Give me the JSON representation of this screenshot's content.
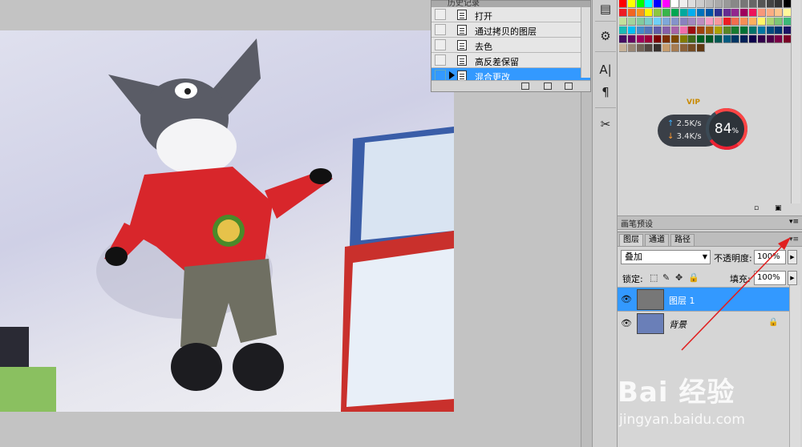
{
  "history": {
    "header_title": "历史记录",
    "items": [
      {
        "label": "打开"
      },
      {
        "label": "通过拷贝的图层"
      },
      {
        "label": "去色"
      },
      {
        "label": "高反差保留"
      },
      {
        "label": "混合更改"
      }
    ],
    "selected_index": 4
  },
  "tools": {
    "char_tool": "A|",
    "paragraph_tool": "¶"
  },
  "network_widget": {
    "vip": "VIP",
    "upload": "2.5K/s",
    "download": "3.4K/s",
    "percent": "84",
    "percent_unit": "%"
  },
  "brush_presets": {
    "tab_label": "画笔预设"
  },
  "layers": {
    "tabs": [
      {
        "label": "图层"
      },
      {
        "label": "通道"
      },
      {
        "label": "路径"
      }
    ],
    "blend_mode": "叠加",
    "opacity_label": "不透明度:",
    "opacity_value": "100%",
    "lock_label": "锁定:",
    "fill_label": "填充:",
    "fill_value": "100%",
    "rows": [
      {
        "name": "图层 1"
      },
      {
        "name": "背景"
      }
    ]
  },
  "watermark": {
    "logo": "Bai 经验",
    "url": "jingyan.baidu.com"
  },
  "colors": {
    "selection": "#3399ff",
    "annotation": "#e02020"
  }
}
